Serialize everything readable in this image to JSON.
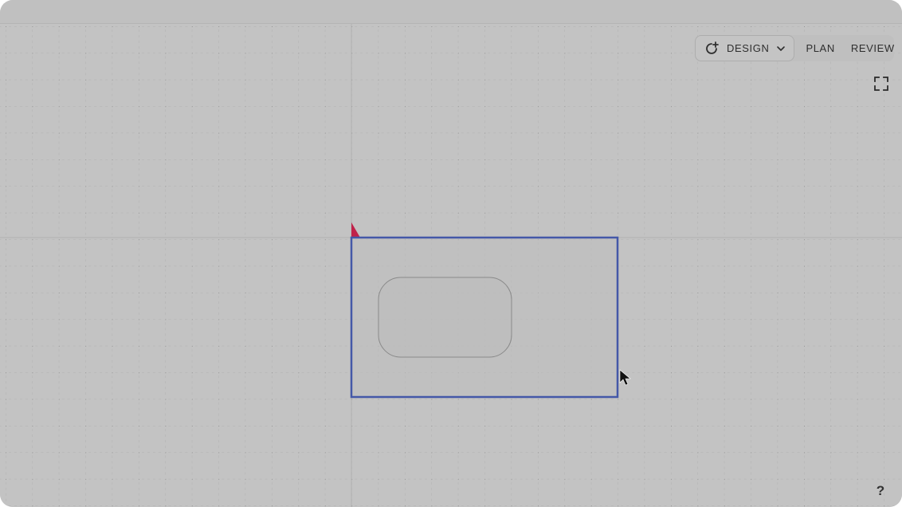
{
  "toolbar": {
    "modes": [
      {
        "label": "DESIGN",
        "icon": "refresh-plus-icon",
        "has_dropdown": true,
        "active": true
      },
      {
        "label": "PLAN",
        "active": false
      },
      {
        "label": "REVIEW",
        "active": false
      }
    ],
    "fullscreen_icon": "fullscreen-icon"
  },
  "help": {
    "label": "?"
  },
  "colors": {
    "canvas_bg": "#c3c3c3",
    "grid_dot": "#8e8e8e",
    "grid_dash": "#a9a9a9",
    "axis_line": "#b0b0b0",
    "selection_stroke": "#4458a8",
    "origin_marker": "#c0224a",
    "shape_stroke": "#8a8a8a"
  },
  "canvas": {
    "selection": {
      "label": ""
    },
    "shape": {
      "type": "rounded-rectangle"
    },
    "cursor_icon": "arrow-cursor-icon"
  }
}
